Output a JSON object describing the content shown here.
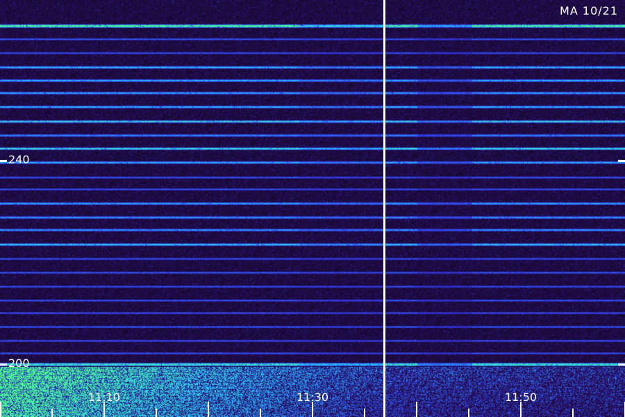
{
  "header": {
    "station_tag": "MA 10/21"
  },
  "frequency_axis": {
    "labels": [
      "240",
      "200"
    ]
  },
  "time_axis": {
    "labels": [
      "11:10",
      "11:30",
      "11:50"
    ]
  },
  "colors": {
    "background": "#12061f",
    "noise": "#2a1a55",
    "carrier": "#3a5cff",
    "strong_carrier": "#3fc9ff",
    "band_signal": "#28f0a0",
    "marker": "#ffffff"
  }
}
